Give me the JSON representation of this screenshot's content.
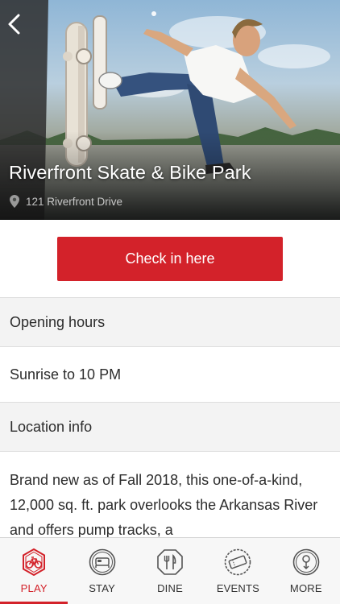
{
  "hero": {
    "title": "Riverfront Skate & Bike Park",
    "address": "121 Riverfront Drive"
  },
  "checkin": {
    "label": "Check in here"
  },
  "sections": {
    "opening_hours_header": "Opening hours",
    "opening_hours_value": "Sunrise to 10 PM",
    "location_header": "Location info",
    "location_description": "Brand new as of Fall 2018, this one-of-a-kind, 12,000 sq. ft. park overlooks the Arkansas River and offers pump tracks, a"
  },
  "tabs": [
    {
      "label": "PLAY",
      "icon": "bike-icon",
      "active": true
    },
    {
      "label": "STAY",
      "icon": "bed-icon",
      "active": false
    },
    {
      "label": "DINE",
      "icon": "fork-knife-icon",
      "active": false
    },
    {
      "label": "EVENTS",
      "icon": "ticket-icon",
      "active": false
    },
    {
      "label": "MORE",
      "icon": "more-icon",
      "active": false
    }
  ],
  "colors": {
    "accent": "#d3222a",
    "section_header_bg": "#f3f3f3",
    "tabbar_bg": "#f7f7f7"
  }
}
